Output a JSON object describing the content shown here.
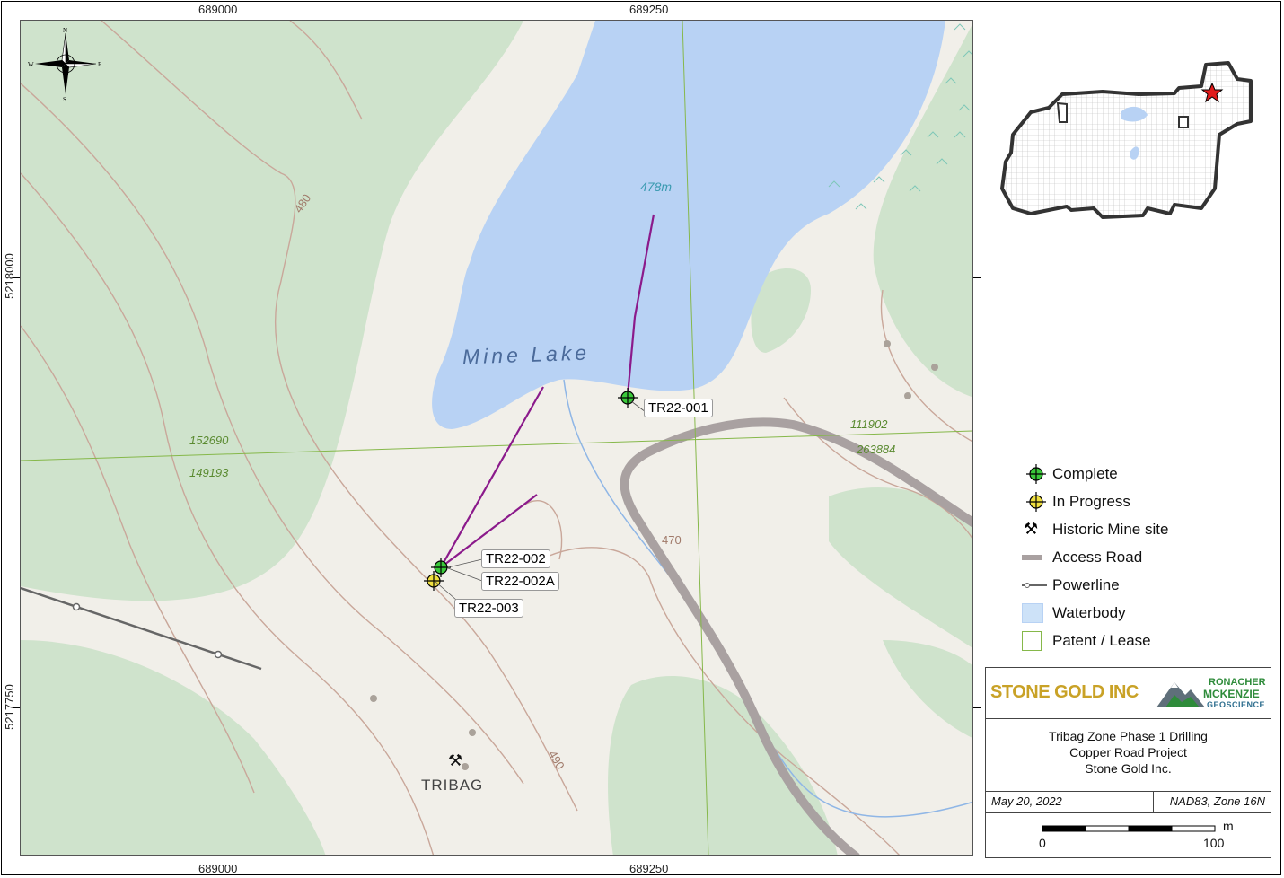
{
  "coords": {
    "top_left": "689000",
    "top_right": "689250",
    "bottom_left": "689000",
    "bottom_right": "689250",
    "left_upper": "5218000",
    "left_lower": "5217750"
  },
  "map_labels": {
    "lake": "Mine Lake",
    "elevation": "478m",
    "contour_480": "480",
    "contour_470": "470",
    "contour_490": "490",
    "claim_a": "152690",
    "claim_b": "149193",
    "claim_c": "111902",
    "claim_d": "263884",
    "historic_site": "TRIBAG"
  },
  "drillholes": [
    {
      "id": "TR22-001",
      "status": "Complete"
    },
    {
      "id": "TR22-002",
      "status": "Complete"
    },
    {
      "id": "TR22-002A",
      "status": "Complete"
    },
    {
      "id": "TR22-003",
      "status": "In Progress"
    }
  ],
  "legend": {
    "complete": "Complete",
    "in_progress": "In Progress",
    "historic_mine": "Historic Mine site",
    "access_road": "Access Road",
    "powerline": "Powerline",
    "waterbody": "Waterbody",
    "patent_lease": "Patent / Lease"
  },
  "compass": {
    "n": "N",
    "s": "S",
    "e": "E",
    "w": "W"
  },
  "title_block": {
    "company_logo": "STONE GOLD INC",
    "partner_logo_line1": "RONACHER",
    "partner_logo_line2": "MCKENZIE",
    "partner_logo_line3": "GEOSCIENCE",
    "line1": "Tribag Zone Phase 1 Drilling",
    "line2": "Copper Road Project",
    "line3": "Stone Gold Inc.",
    "date": "May 20, 2022",
    "datum": "NAD83, Zone 16N",
    "scale_unit": "m",
    "scale_min": "0",
    "scale_max": "100"
  },
  "colors": {
    "forest": "#cfe3cc",
    "open": "#f1efe9",
    "water": "#b8d2f4",
    "road": "#a9a1a1",
    "contour": "#c9a79a",
    "claim_line": "#86b84a",
    "drill_trace": "#8b1a8b",
    "complete": "#3ac93a",
    "in_progress": "#f0e040"
  }
}
